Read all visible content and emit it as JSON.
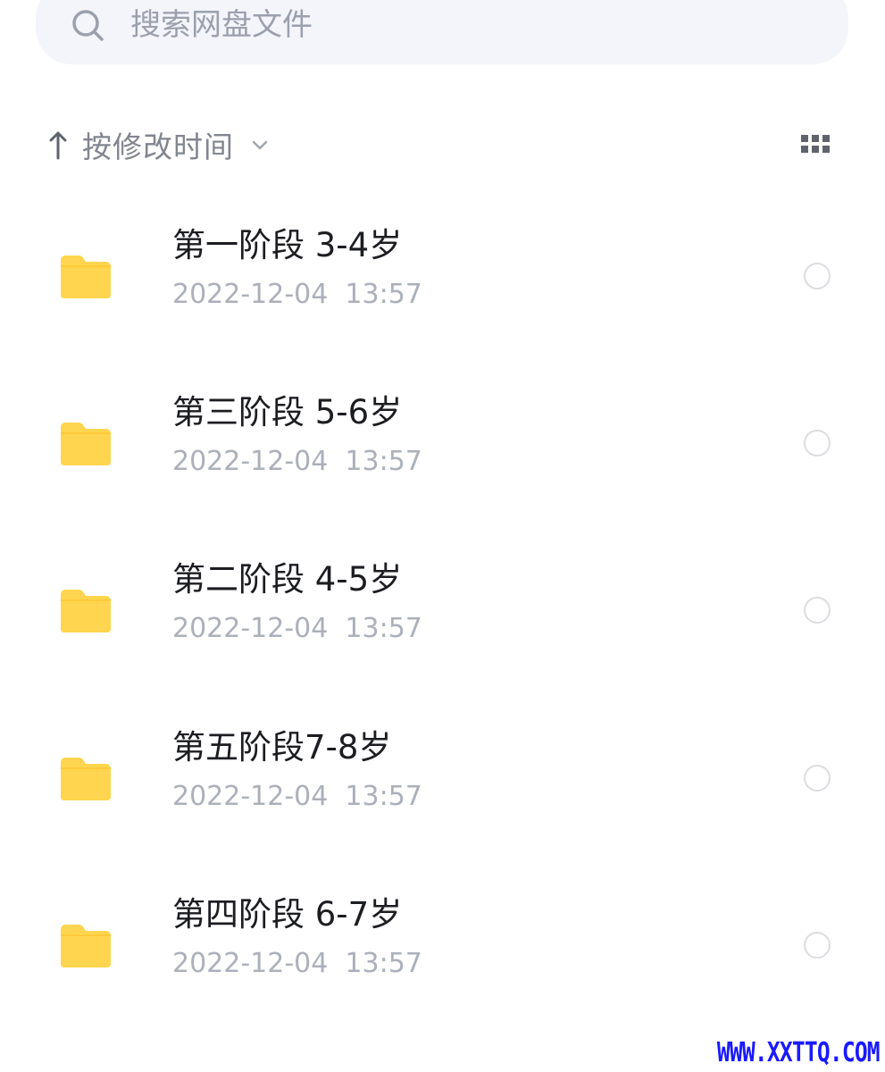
{
  "search": {
    "placeholder": "搜索网盘文件"
  },
  "sort": {
    "label": "按修改时间"
  },
  "files": [
    {
      "name": "第一阶段 3-4岁",
      "date": "2022-12-04  13:57"
    },
    {
      "name": "第三阶段 5-6岁",
      "date": "2022-12-04  13:57"
    },
    {
      "name": "第二阶段 4-5岁",
      "date": "2022-12-04  13:57"
    },
    {
      "name": "第五阶段7-8岁",
      "date": "2022-12-04  13:57"
    },
    {
      "name": "第四阶段 6-7岁",
      "date": "2022-12-04  13:57"
    }
  ],
  "watermark": "WWW.XXTTQ.COM",
  "colors": {
    "folder": "#ffd54f",
    "search_bg": "#f4f5fa",
    "muted_text": "#abb0bb",
    "watermark": "#1a1aff"
  },
  "icons": [
    "search-icon",
    "sort-arrow-icon",
    "chevron-down-icon",
    "grid-view-icon",
    "folder-icon"
  ]
}
